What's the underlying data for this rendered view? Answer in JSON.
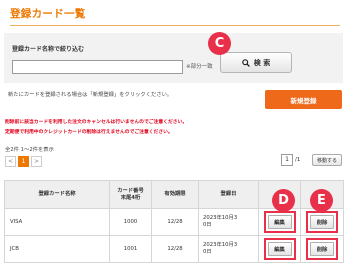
{
  "page": {
    "title": "登録カード一覧"
  },
  "search": {
    "label": "登録カード名称で絞り込む",
    "value": "",
    "placeholder": "",
    "partial_match_label": "※部分一致",
    "button_label": "検 索"
  },
  "markers": {
    "c": "C",
    "d": "D",
    "e": "E"
  },
  "new_registration": {
    "note": "新たにカードを登録される場合は「新規登録」をクリックください。",
    "button_label": "新規登録"
  },
  "warnings": [
    "削除前に該当カードを利用した注文のキャンセルは行いませんのでご注意ください。",
    "定期便で利用中のクレジットカードの削除は行えませんのでご注意ください。"
  ],
  "pagination": {
    "summary": "全2件 1〜2件を表示",
    "prev_label": "<",
    "current_page": "1",
    "next_label": ">",
    "page_input": "1",
    "page_total": "/1",
    "move_button": "移動する"
  },
  "table": {
    "headers": {
      "name": "登録カード名称",
      "number_line1": "カード番号",
      "number_line2": "末尾4桁",
      "expiry": "有効期限",
      "registered_date": "登録日",
      "edit": "",
      "delete": ""
    },
    "rows": [
      {
        "name": "VISA",
        "number": "1000",
        "expiry": "12/28",
        "date_line1": "2023年10月3",
        "date_line2": "0日",
        "edit_label": "編集",
        "delete_label": "削除"
      },
      {
        "name": "JCB",
        "number": "1001",
        "expiry": "12/28",
        "date_line1": "2023年10月3",
        "date_line2": "0日",
        "edit_label": "編集",
        "delete_label": "削除"
      }
    ]
  },
  "colors": {
    "accent": "#ee7700",
    "new_button": "#ee6a1a",
    "warning_text": "#e3001b",
    "marker": "#e8304a"
  },
  "icons": {
    "search": "magnifier-icon"
  }
}
